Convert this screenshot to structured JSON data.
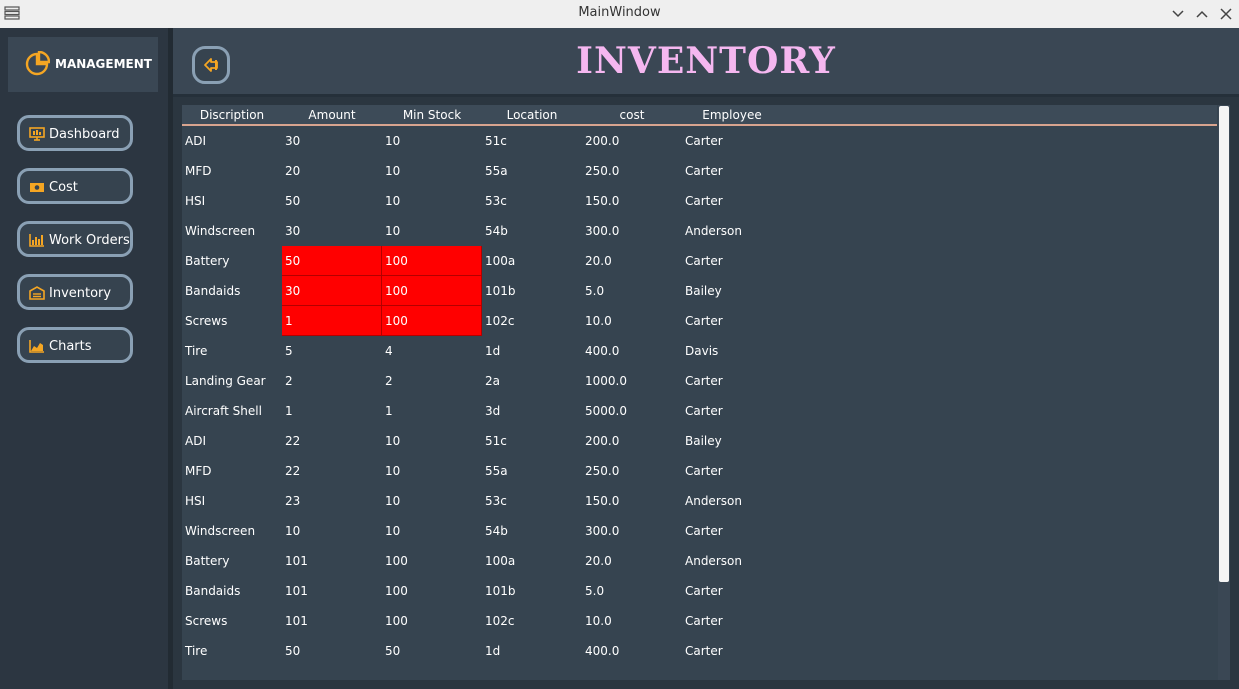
{
  "window": {
    "title": "MainWindow"
  },
  "sidebar": {
    "brand": "MANAGEMENT",
    "items": [
      {
        "label": "Dashboard",
        "icon": "dashboard-monitor-icon"
      },
      {
        "label": "Cost",
        "icon": "banknote-icon"
      },
      {
        "label": "Work Orders",
        "icon": "bar-chart-icon"
      },
      {
        "label": "Inventory",
        "icon": "warehouse-icon"
      },
      {
        "label": "Charts",
        "icon": "line-chart-icon"
      }
    ]
  },
  "header": {
    "title": "INVENTORY",
    "back_icon": "sign-out-arrow-icon"
  },
  "colors": {
    "accent": "#f5a623",
    "title": "#f5b7f0",
    "alert": "#ff0000",
    "button_border": "#8aa0b4"
  },
  "table": {
    "columns": [
      "Discription",
      "Amount",
      "Min Stock",
      "Location",
      "cost",
      "Employee"
    ],
    "rows": [
      {
        "cells": [
          "ADI",
          "30",
          "10",
          "51c",
          "200.0",
          "Carter"
        ],
        "alert": false
      },
      {
        "cells": [
          "MFD",
          "20",
          "10",
          "55a",
          "250.0",
          "Carter"
        ],
        "alert": false
      },
      {
        "cells": [
          "HSI",
          "50",
          "10",
          "53c",
          "150.0",
          "Carter"
        ],
        "alert": false
      },
      {
        "cells": [
          "Windscreen",
          "30",
          "10",
          "54b",
          "300.0",
          "Anderson"
        ],
        "alert": false
      },
      {
        "cells": [
          "Battery",
          "50",
          "100",
          "100a",
          "20.0",
          "Carter"
        ],
        "alert": true
      },
      {
        "cells": [
          "Bandaids",
          "30",
          "100",
          "101b",
          "5.0",
          "Bailey"
        ],
        "alert": true
      },
      {
        "cells": [
          "Screws",
          "1",
          "100",
          "102c",
          "10.0",
          "Carter"
        ],
        "alert": true
      },
      {
        "cells": [
          "Tire",
          "5",
          "4",
          "1d",
          "400.0",
          "Davis"
        ],
        "alert": false
      },
      {
        "cells": [
          "Landing Gear",
          "2",
          "2",
          "2a",
          "1000.0",
          "Carter"
        ],
        "alert": false
      },
      {
        "cells": [
          "Aircraft Shell",
          "1",
          "1",
          "3d",
          "5000.0",
          "Carter"
        ],
        "alert": false
      },
      {
        "cells": [
          "ADI",
          "22",
          "10",
          "51c",
          "200.0",
          "Bailey"
        ],
        "alert": false
      },
      {
        "cells": [
          "MFD",
          "22",
          "10",
          "55a",
          "250.0",
          "Carter"
        ],
        "alert": false
      },
      {
        "cells": [
          "HSI",
          "23",
          "10",
          "53c",
          "150.0",
          "Anderson"
        ],
        "alert": false
      },
      {
        "cells": [
          "Windscreen",
          "10",
          "10",
          "54b",
          "300.0",
          "Carter"
        ],
        "alert": false
      },
      {
        "cells": [
          "Battery",
          "101",
          "100",
          "100a",
          "20.0",
          "Anderson"
        ],
        "alert": false
      },
      {
        "cells": [
          "Bandaids",
          "101",
          "100",
          "101b",
          "5.0",
          "Carter"
        ],
        "alert": false
      },
      {
        "cells": [
          "Screws",
          "101",
          "100",
          "102c",
          "10.0",
          "Carter"
        ],
        "alert": false
      },
      {
        "cells": [
          "Tire",
          "50",
          "50",
          "1d",
          "400.0",
          "Carter"
        ],
        "alert": false
      }
    ]
  }
}
